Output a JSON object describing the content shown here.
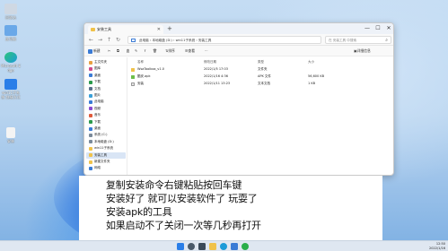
{
  "desktop_icons": [
    {
      "label": "回收站",
      "icon": "recycle-bin-icon",
      "color": "#cfd8e3"
    },
    {
      "label": "此电脑",
      "icon": "this-pc-icon",
      "color": "#6aa8e8"
    },
    {
      "label": "Microsoft Edge",
      "icon": "edge-icon",
      "color": "#1c9bd8"
    },
    {
      "label": "win11子系统 快捷方式",
      "icon": "shortcut-icon",
      "color": "#e8f0f8"
    },
    {
      "label": "安装",
      "icon": "file-icon",
      "color": "#f4f4f4"
    }
  ],
  "window": {
    "tab_title": "安装工具",
    "new_tab": "+",
    "minimize": "—",
    "maximize": "☐",
    "close": "✕",
    "address_parts": [
      "此电脑",
      "本地磁盘 (D:)",
      "win11子系统",
      "安装工具"
    ],
    "search_placeholder": "在 安装工具 中搜索",
    "commands": {
      "new": "新建",
      "sort": "排序",
      "view": "查看",
      "more": "···",
      "details": "详细信息"
    },
    "columns": {
      "name": "名称",
      "date": "修改日期",
      "type": "类型",
      "size": "大小"
    },
    "files": [
      {
        "name": "WsaToolbox_v1.0",
        "date": "2022/1/5 17:03",
        "type": "文件夹",
        "size": "",
        "color": "#f0c24a"
      },
      {
        "name": "酷安.apk",
        "date": "2022/1/16 4:36",
        "type": "APK 文件",
        "size": "56,600 KB",
        "color": "#6cbf4a"
      },
      {
        "name": "安装",
        "date": "2022/1/11 13:23",
        "type": "文本文档",
        "size": "1 KB",
        "color": "#e4e4e4"
      }
    ],
    "sidebar": [
      {
        "label": "主文件夹",
        "color": "#e8a040",
        "sel": false
      },
      {
        "label": "图库",
        "color": "#d04a8a",
        "sel": false
      },
      {
        "label": "桌面",
        "color": "#3a7bd5",
        "sel": false
      },
      {
        "label": "下载",
        "color": "#2a9a4a",
        "sel": false
      },
      {
        "label": "文档",
        "color": "#5a6f8a",
        "sel": false
      },
      {
        "label": "图片",
        "color": "#3aa0d8",
        "sel": false
      },
      {
        "label": "此电脑",
        "color": "#3a7bd5",
        "sel": false
      },
      {
        "label": "视频",
        "color": "#8a4ad0",
        "sel": false
      },
      {
        "label": "音乐",
        "color": "#e05a3a",
        "sel": false
      },
      {
        "label": "下载",
        "color": "#2a9a4a",
        "sel": false
      },
      {
        "label": "桌面",
        "color": "#3a7bd5",
        "sel": false
      },
      {
        "label": "系统 (C:)",
        "color": "#7a8a9a",
        "sel": false
      },
      {
        "label": "本地磁盘 (D:)",
        "color": "#7a8a9a",
        "sel": false
      },
      {
        "label": "win11子系统",
        "color": "#f0c24a",
        "sel": false
      },
      {
        "label": "安装工具",
        "color": "#f0c24a",
        "sel": true
      },
      {
        "label": "新建文件夹",
        "color": "#f0c24a",
        "sel": false
      },
      {
        "label": "网络",
        "color": "#3a7bd5",
        "sel": false
      }
    ]
  },
  "subtitles": [
    "复制安装命令右键粘贴按回车键",
    "安装好了  就可以安装软件了 玩耍了",
    "安装apk的工具",
    "如果启动不了关闭一次等几秒再打开"
  ],
  "taskbar": {
    "apps": [
      {
        "icon": "start-icon",
        "color": "#2a7ee8"
      },
      {
        "icon": "search-icon",
        "color": "#4a5a6a"
      },
      {
        "icon": "task-view-icon",
        "color": "#3a4a5a"
      },
      {
        "icon": "file-explorer-icon",
        "color": "#f0c24a"
      },
      {
        "icon": "edge-icon",
        "color": "#1c9bd8"
      },
      {
        "icon": "store-icon",
        "color": "#3a7bd5"
      },
      {
        "icon": "wechat-icon",
        "color": "#2aae4a"
      }
    ],
    "time": "12:50",
    "date": "2022/1/16"
  }
}
